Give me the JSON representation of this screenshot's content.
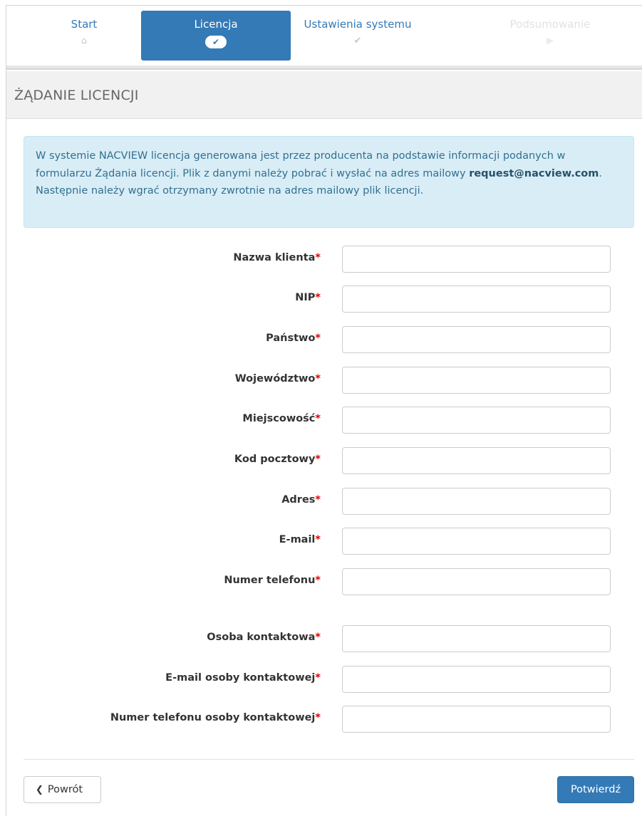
{
  "wizard": {
    "steps": [
      {
        "label": "Start",
        "icon": "home-icon",
        "glyph": "⌂"
      },
      {
        "label": "Licencja",
        "icon": "check-icon",
        "glyph": "✔"
      },
      {
        "label": "Ustawienia systemu",
        "icon": "check-icon",
        "glyph": "✔"
      },
      {
        "label": "Podsumowanie",
        "icon": "play-icon",
        "glyph": "▶"
      }
    ]
  },
  "panel": {
    "title": "ŻĄDANIE LICENCJI"
  },
  "info": {
    "text_before": "W systemie NACVIEW licencja generowana jest przez producenta na podstawie informacji podanych w formularzu Żądania licencji. Plik z danymi należy pobrać i wysłać na adres mailowy ",
    "email": "request@nacview.com",
    "text_after": ". Następnie należy wgrać otrzymany zwrotnie na adres mailowy plik licencji."
  },
  "form": {
    "required_marker": "*",
    "fields": [
      {
        "label": "Nazwa klienta",
        "value": ""
      },
      {
        "label": "NIP",
        "value": ""
      },
      {
        "label": "Państwo",
        "value": ""
      },
      {
        "label": "Województwo",
        "value": ""
      },
      {
        "label": "Miejscowość",
        "value": ""
      },
      {
        "label": "Kod pocztowy",
        "value": ""
      },
      {
        "label": "Adres",
        "value": ""
      },
      {
        "label": "E-mail",
        "value": ""
      },
      {
        "label": "Numer telefonu",
        "value": ""
      },
      {
        "label": "Osoba kontaktowa",
        "value": ""
      },
      {
        "label": "E-mail osoby kontaktowej",
        "value": ""
      },
      {
        "label": "Numer telefonu osoby kontaktowej",
        "value": ""
      }
    ]
  },
  "buttons": {
    "back_label": "Powrót",
    "back_glyph": "❮",
    "confirm_label": "Potwierdź"
  },
  "colors": {
    "primary": "#337ab7",
    "info_bg": "#d9edf7",
    "info_text": "#31708f",
    "required": "#e00000"
  }
}
